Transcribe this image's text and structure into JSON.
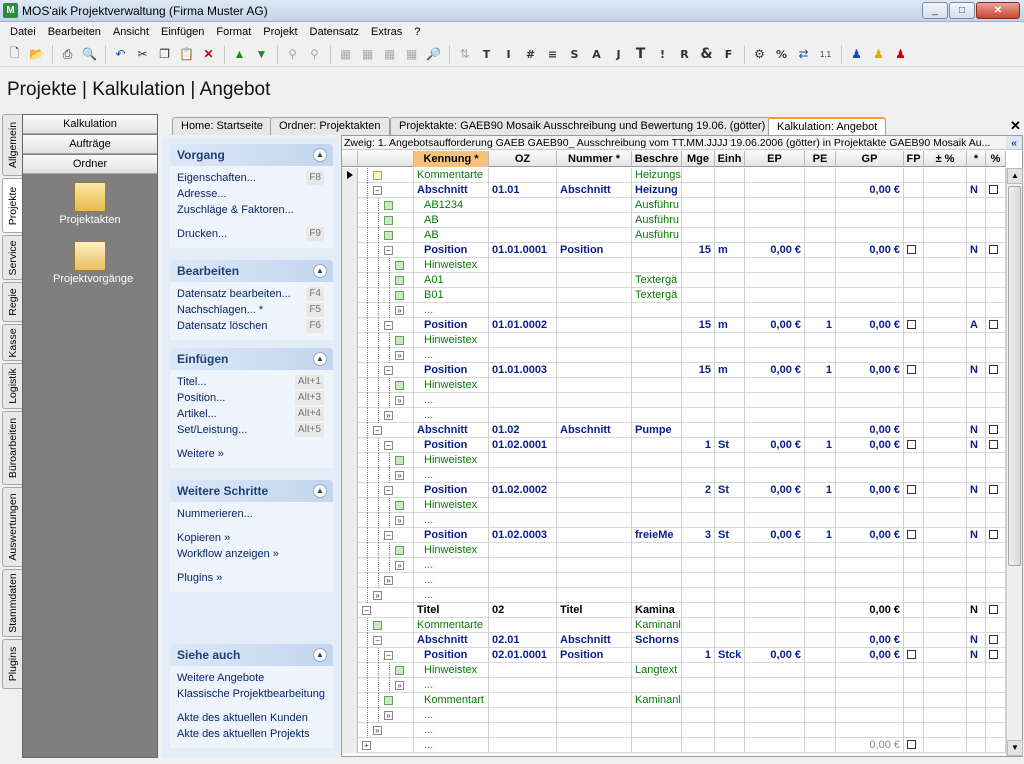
{
  "window": {
    "title": "MOS'aik Projektverwaltung (Firma Muster AG)",
    "min": "_",
    "max": "□",
    "close": "✕"
  },
  "menu": [
    "Datei",
    "Bearbeiten",
    "Ansicht",
    "Einfügen",
    "Format",
    "Projekt",
    "Datensatz",
    "Extras",
    "?"
  ],
  "page_title": "Projekte | Kalkulation | Angebot",
  "vtabs": [
    "Allgemein",
    "Projekte",
    "Service",
    "Regie",
    "Kasse",
    "Logistik",
    "Büroarbeiten",
    "Auswertungen",
    "Stammdaten",
    "Plugins"
  ],
  "nav": {
    "buttons": [
      "Kalkulation",
      "Aufträge",
      "Ordner"
    ],
    "icons": [
      "Projektakten",
      "Projektvorgänge"
    ]
  },
  "tasks": {
    "vorgang": {
      "title": "Vorgang",
      "items": [
        {
          "label": "Eigenschaften...",
          "key": "F8"
        },
        {
          "label": "Adresse...",
          "key": ""
        },
        {
          "label": "Zuschläge & Faktoren...",
          "key": ""
        },
        {
          "label": "Drucken...",
          "key": "F9"
        }
      ]
    },
    "bearbeiten": {
      "title": "Bearbeiten",
      "items": [
        {
          "label": "Datensatz bearbeiten...",
          "key": "F4"
        },
        {
          "label": "Nachschlagen... *",
          "key": "F5"
        },
        {
          "label": "Datensatz löschen",
          "key": "F6"
        }
      ]
    },
    "einfuegen": {
      "title": "Einfügen",
      "items": [
        {
          "label": "Titel...",
          "key": "Alt+1"
        },
        {
          "label": "Position...",
          "key": "Alt+3"
        },
        {
          "label": "Artikel...",
          "key": "Alt+4"
        },
        {
          "label": "Set/Leistung...",
          "key": "Alt+5"
        },
        {
          "label": "Weitere »",
          "key": ""
        }
      ]
    },
    "weitere": {
      "title": "Weitere Schritte",
      "items": [
        {
          "label": "Nummerieren...",
          "key": ""
        },
        {
          "label": "Kopieren »",
          "key": ""
        },
        {
          "label": "Workflow anzeigen »",
          "key": ""
        },
        {
          "label": "Plugins »",
          "key": ""
        }
      ]
    },
    "siehe": {
      "title": "Siehe auch",
      "items": [
        {
          "label": "Weitere Angebote",
          "key": ""
        },
        {
          "label": "Klassische Projektbearbeitung",
          "key": ""
        },
        {
          "label": "Akte des aktuellen Kunden",
          "key": ""
        },
        {
          "label": "Akte des aktuellen Projekts",
          "key": ""
        }
      ]
    }
  },
  "doc_tabs": [
    "Home: Startseite",
    "Ordner: Projektakten",
    "Projektakte: GAEB90 Mosaik Ausschreibung und Bewertung 19.06. (götter)",
    "Kalkulation: Angebot"
  ],
  "branch": "Zweig: 1. Angebotsaufforderung GAEB GAEB90_ Ausschreibung vom TT.MM.JJJJ 19.06.2006 (götter) in Projektakte GAEB90 Mosaik Au...",
  "columns": [
    "Kennung *",
    "OZ",
    "Nummer *",
    "Beschre",
    "Mge",
    "Einh",
    "EP",
    "PE",
    "GP",
    "FP",
    "± %",
    "*",
    "%"
  ],
  "rows": [
    {
      "d": 0,
      "n": "fold",
      "t": "komm",
      "k": "Kommentarte",
      "oz": "",
      "nr": "",
      "b": "Heizungs",
      "m": "",
      "e": "",
      "ep": "",
      "pe": "",
      "gp": "",
      "fp": false,
      "s": "",
      "pc": false,
      "cur": true
    },
    {
      "d": 0,
      "n": "minus",
      "t": "abschnitt",
      "k": "Abschnitt",
      "oz": "01.01",
      "nr": "Abschnitt",
      "b": "Heizung",
      "m": "",
      "e": "",
      "ep": "",
      "pe": "",
      "gp": "0,00 €",
      "fp": false,
      "s": "N",
      "pc": true
    },
    {
      "d": 1,
      "n": "leaf",
      "t": "komm",
      "k": "AB1234",
      "oz": "",
      "nr": "",
      "b": "Ausführu",
      "m": "",
      "e": "",
      "ep": "",
      "pe": "",
      "gp": "",
      "fp": false,
      "s": "",
      "pc": false
    },
    {
      "d": 1,
      "n": "leaf",
      "t": "komm",
      "k": "AB",
      "oz": "",
      "nr": "",
      "b": "Ausführu",
      "m": "",
      "e": "",
      "ep": "",
      "pe": "",
      "gp": "",
      "fp": false,
      "s": "",
      "pc": false
    },
    {
      "d": 1,
      "n": "leaf",
      "t": "komm",
      "k": "AB",
      "oz": "",
      "nr": "",
      "b": "Ausführu",
      "m": "",
      "e": "",
      "ep": "",
      "pe": "",
      "gp": "",
      "fp": false,
      "s": "",
      "pc": false
    },
    {
      "d": 1,
      "n": "minus",
      "t": "position",
      "k": "Position",
      "oz": "01.01.0001",
      "nr": "Position",
      "b": "",
      "m": "15",
      "e": "m",
      "ep": "0,00 €",
      "pe": "",
      "gp": "0,00 €",
      "fp": true,
      "s": "N",
      "pc": true
    },
    {
      "d": 2,
      "n": "leaf",
      "t": "hinweis",
      "k": "Hinweistex",
      "oz": "",
      "nr": "",
      "b": "",
      "m": "",
      "e": "",
      "ep": "",
      "pe": "",
      "gp": "",
      "fp": false,
      "s": "",
      "pc": false
    },
    {
      "d": 2,
      "n": "leaf",
      "t": "text",
      "k": "A01",
      "oz": "",
      "nr": "",
      "b": "Textergä",
      "m": "",
      "e": "",
      "ep": "",
      "pe": "",
      "gp": "",
      "fp": false,
      "s": "",
      "pc": false
    },
    {
      "d": 2,
      "n": "leaf",
      "t": "text",
      "k": "B01",
      "oz": "",
      "nr": "",
      "b": "Textergä",
      "m": "",
      "e": "",
      "ep": "",
      "pe": "",
      "gp": "",
      "fp": false,
      "s": "",
      "pc": false
    },
    {
      "d": 2,
      "n": "more",
      "t": "more",
      "k": "...",
      "oz": "",
      "nr": "",
      "b": "",
      "m": "",
      "e": "",
      "ep": "",
      "pe": "",
      "gp": "",
      "fp": false,
      "s": "",
      "pc": false
    },
    {
      "d": 1,
      "n": "minus",
      "t": "position",
      "k": "Position",
      "oz": "01.01.0002",
      "nr": "",
      "b": "",
      "m": "15",
      "e": "m",
      "ep": "0,00 €",
      "pe": "1",
      "gp": "0,00 €",
      "fp": true,
      "s": "A",
      "pc": true
    },
    {
      "d": 2,
      "n": "leaf",
      "t": "hinweis",
      "k": "Hinweistex",
      "oz": "",
      "nr": "",
      "b": "",
      "m": "",
      "e": "",
      "ep": "",
      "pe": "",
      "gp": "",
      "fp": false,
      "s": "",
      "pc": false
    },
    {
      "d": 2,
      "n": "more",
      "t": "more",
      "k": "...",
      "oz": "",
      "nr": "",
      "b": "",
      "m": "",
      "e": "",
      "ep": "",
      "pe": "",
      "gp": "",
      "fp": false,
      "s": "",
      "pc": false
    },
    {
      "d": 1,
      "n": "minus",
      "t": "position",
      "k": "Position",
      "oz": "01.01.0003",
      "nr": "",
      "b": "",
      "m": "15",
      "e": "m",
      "ep": "0,00 €",
      "pe": "1",
      "gp": "0,00 €",
      "fp": true,
      "s": "N",
      "pc": true
    },
    {
      "d": 2,
      "n": "leaf",
      "t": "hinweis",
      "k": "Hinweistex",
      "oz": "",
      "nr": "",
      "b": "",
      "m": "",
      "e": "",
      "ep": "",
      "pe": "",
      "gp": "",
      "fp": false,
      "s": "",
      "pc": false
    },
    {
      "d": 2,
      "n": "more",
      "t": "more",
      "k": "...",
      "oz": "",
      "nr": "",
      "b": "",
      "m": "",
      "e": "",
      "ep": "",
      "pe": "",
      "gp": "",
      "fp": false,
      "s": "",
      "pc": false
    },
    {
      "d": 1,
      "n": "more",
      "t": "more",
      "k": "...",
      "oz": "",
      "nr": "",
      "b": "",
      "m": "",
      "e": "",
      "ep": "",
      "pe": "",
      "gp": "",
      "fp": false,
      "s": "",
      "pc": false
    },
    {
      "d": 0,
      "n": "minus",
      "t": "abschnitt",
      "k": "Abschnitt",
      "oz": "01.02",
      "nr": "Abschnitt",
      "b": "Pumpe",
      "m": "",
      "e": "",
      "ep": "",
      "pe": "",
      "gp": "0,00 €",
      "fp": false,
      "s": "N",
      "pc": true
    },
    {
      "d": 1,
      "n": "minus",
      "t": "position",
      "k": "Position",
      "oz": "01.02.0001",
      "nr": "",
      "b": "",
      "m": "1",
      "e": "St",
      "ep": "0,00 €",
      "pe": "1",
      "gp": "0,00 €",
      "fp": true,
      "s": "N",
      "pc": true
    },
    {
      "d": 2,
      "n": "leaf",
      "t": "hinweis",
      "k": "Hinweistex",
      "oz": "",
      "nr": "",
      "b": "",
      "m": "",
      "e": "",
      "ep": "",
      "pe": "",
      "gp": "",
      "fp": false,
      "s": "",
      "pc": false
    },
    {
      "d": 2,
      "n": "more",
      "t": "more",
      "k": "...",
      "oz": "",
      "nr": "",
      "b": "",
      "m": "",
      "e": "",
      "ep": "",
      "pe": "",
      "gp": "",
      "fp": false,
      "s": "",
      "pc": false
    },
    {
      "d": 1,
      "n": "minus",
      "t": "position",
      "k": "Position",
      "oz": "01.02.0002",
      "nr": "",
      "b": "",
      "m": "2",
      "e": "St",
      "ep": "0,00 €",
      "pe": "1",
      "gp": "0,00 €",
      "fp": true,
      "s": "N",
      "pc": true
    },
    {
      "d": 2,
      "n": "leaf",
      "t": "hinweis",
      "k": "Hinweistex",
      "oz": "",
      "nr": "",
      "b": "",
      "m": "",
      "e": "",
      "ep": "",
      "pe": "",
      "gp": "",
      "fp": false,
      "s": "",
      "pc": false
    },
    {
      "d": 2,
      "n": "more",
      "t": "more",
      "k": "...",
      "oz": "",
      "nr": "",
      "b": "",
      "m": "",
      "e": "",
      "ep": "",
      "pe": "",
      "gp": "",
      "fp": false,
      "s": "",
      "pc": false
    },
    {
      "d": 1,
      "n": "minus",
      "t": "position",
      "k": "Position",
      "oz": "01.02.0003",
      "nr": "",
      "b": "freieMe",
      "m": "3",
      "e": "St",
      "ep": "0,00 €",
      "pe": "1",
      "gp": "0,00 €",
      "fp": true,
      "s": "N",
      "pc": true
    },
    {
      "d": 2,
      "n": "leaf",
      "t": "hinweis",
      "k": "Hinweistex",
      "oz": "",
      "nr": "",
      "b": "",
      "m": "",
      "e": "",
      "ep": "",
      "pe": "",
      "gp": "",
      "fp": false,
      "s": "",
      "pc": false
    },
    {
      "d": 2,
      "n": "more",
      "t": "more",
      "k": "...",
      "oz": "",
      "nr": "",
      "b": "",
      "m": "",
      "e": "",
      "ep": "",
      "pe": "",
      "gp": "",
      "fp": false,
      "s": "",
      "pc": false
    },
    {
      "d": 1,
      "n": "more",
      "t": "more",
      "k": "...",
      "oz": "",
      "nr": "",
      "b": "",
      "m": "",
      "e": "",
      "ep": "",
      "pe": "",
      "gp": "",
      "fp": false,
      "s": "",
      "pc": false
    },
    {
      "d": 0,
      "n": "more",
      "t": "more",
      "k": "...",
      "oz": "",
      "nr": "",
      "b": "",
      "m": "",
      "e": "",
      "ep": "",
      "pe": "",
      "gp": "",
      "fp": false,
      "s": "",
      "pc": false
    },
    {
      "d": -1,
      "n": "minus",
      "t": "titel",
      "k": "Titel",
      "oz": "02",
      "nr": "Titel",
      "b": "Kamina",
      "m": "",
      "e": "",
      "ep": "",
      "pe": "",
      "gp": "0,00 €",
      "fp": false,
      "s": "N",
      "pc": true
    },
    {
      "d": 0,
      "n": "leaf",
      "t": "komm",
      "k": "Kommentarte",
      "oz": "",
      "nr": "",
      "b": "Kaminanl",
      "m": "",
      "e": "",
      "ep": "",
      "pe": "",
      "gp": "",
      "fp": false,
      "s": "",
      "pc": false
    },
    {
      "d": 0,
      "n": "minus",
      "t": "abschnitt",
      "k": "Abschnitt",
      "oz": "02.01",
      "nr": "Abschnitt",
      "b": "Schorns",
      "m": "",
      "e": "",
      "ep": "",
      "pe": "",
      "gp": "0,00 €",
      "fp": false,
      "s": "N",
      "pc": true
    },
    {
      "d": 1,
      "n": "minus",
      "t": "position",
      "k": "Position",
      "oz": "02.01.0001",
      "nr": "Position",
      "b": "",
      "m": "1",
      "e": "Stck",
      "ep": "0,00 €",
      "pe": "",
      "gp": "0,00 €",
      "fp": true,
      "s": "N",
      "pc": true
    },
    {
      "d": 2,
      "n": "leaf",
      "t": "hinweis",
      "k": "Hinweistex",
      "oz": "",
      "nr": "",
      "b": "Langtext",
      "m": "",
      "e": "",
      "ep": "",
      "pe": "",
      "gp": "",
      "fp": false,
      "s": "",
      "pc": false
    },
    {
      "d": 2,
      "n": "more",
      "t": "more",
      "k": "...",
      "oz": "",
      "nr": "",
      "b": "",
      "m": "",
      "e": "",
      "ep": "",
      "pe": "",
      "gp": "",
      "fp": false,
      "s": "",
      "pc": false
    },
    {
      "d": 1,
      "n": "leaf",
      "t": "komm",
      "k": "Kommentart",
      "oz": "",
      "nr": "",
      "b": "Kaminanl",
      "m": "",
      "e": "",
      "ep": "",
      "pe": "",
      "gp": "",
      "fp": false,
      "s": "",
      "pc": false
    },
    {
      "d": 1,
      "n": "more",
      "t": "more",
      "k": "...",
      "oz": "",
      "nr": "",
      "b": "",
      "m": "",
      "e": "",
      "ep": "",
      "pe": "",
      "gp": "",
      "fp": false,
      "s": "",
      "pc": false
    },
    {
      "d": 0,
      "n": "more",
      "t": "more",
      "k": "...",
      "oz": "",
      "nr": "",
      "b": "",
      "m": "",
      "e": "",
      "ep": "",
      "pe": "",
      "gp": "",
      "fp": false,
      "s": "",
      "pc": false
    },
    {
      "d": -1,
      "n": "plus",
      "t": "more",
      "k": "...",
      "oz": "",
      "nr": "",
      "b": "",
      "m": "",
      "e": "",
      "ep": "",
      "pe": "",
      "gp": "0,00 €",
      "fp": true,
      "s": "",
      "pc": false,
      "sum": true
    }
  ]
}
